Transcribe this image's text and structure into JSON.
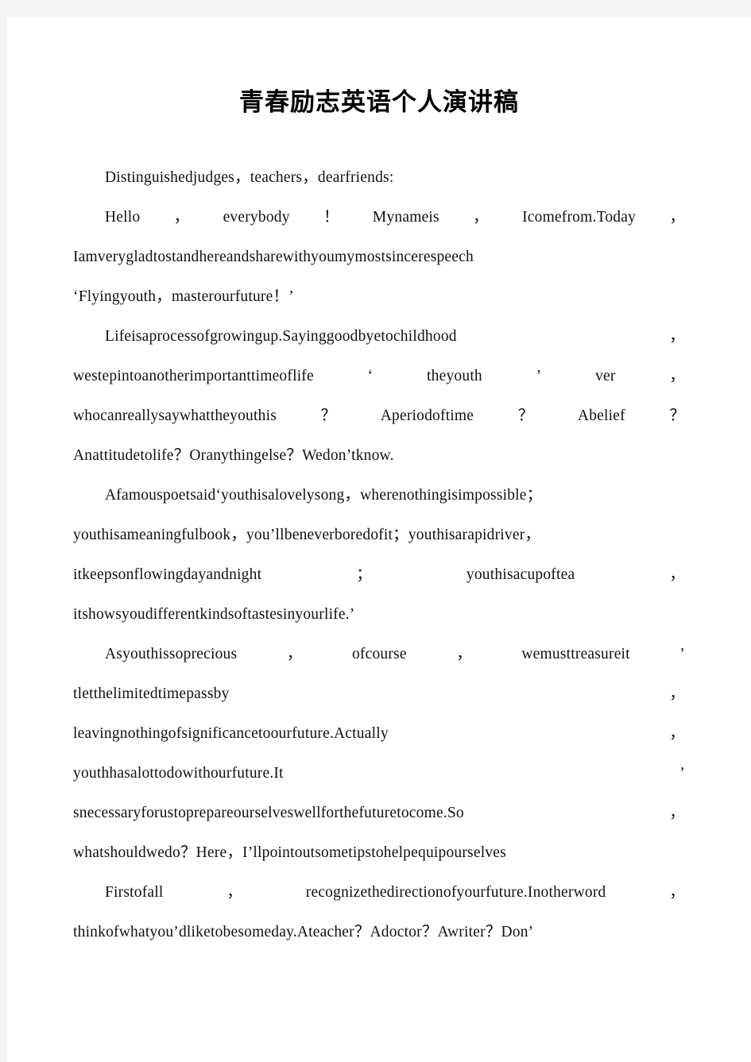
{
  "document": {
    "title": "青春励志英语个人演讲稿",
    "page_background": "#ffffff",
    "canvas_background": "#f4f4f4",
    "text_color": "#111111"
  },
  "paragraphs": [
    {
      "id": "salutation",
      "lines": [
        {
          "indent": true,
          "justify": false,
          "segments": [
            "Distinguishedjudges，teachers，dearfriends:"
          ]
        },
        {
          "indent": true,
          "justify": true,
          "segments": [
            "Hello",
            "，",
            "everybody",
            "！",
            "Mynameis",
            "，",
            "Icomefrom.Today",
            "，"
          ]
        },
        {
          "indent": false,
          "justify": false,
          "segments": [
            "Iamverygladtostandhereandsharewithyoumymostsincerespeech"
          ]
        },
        {
          "indent": false,
          "justify": false,
          "segments": [
            "‘Flyingyouth，masterourfuture！’"
          ]
        }
      ]
    },
    {
      "id": "life-process",
      "lines": [
        {
          "indent": true,
          "justify": true,
          "segments": [
            "Lifeisaprocessofgrowingup.Sayinggoodbyetochildhood",
            "，"
          ]
        },
        {
          "indent": false,
          "justify": true,
          "segments": [
            "westepintoanotherimportanttimeoflife",
            "‘",
            "theyouth",
            "’",
            "ver",
            "，"
          ]
        },
        {
          "indent": false,
          "justify": true,
          "segments": [
            "whocanreallysaywhattheyouthis",
            "？",
            "Aperiodoftime",
            "？",
            "Abelief",
            "？"
          ]
        },
        {
          "indent": false,
          "justify": false,
          "segments": [
            "Anattitudetolife？Oranythingelse？Wedon’tknow."
          ]
        }
      ]
    },
    {
      "id": "famous-poet",
      "lines": [
        {
          "indent": true,
          "justify": false,
          "segments": [
            "Afamouspoetsaid‘youthisalovelysong，wherenothingisimpossible；"
          ]
        },
        {
          "indent": false,
          "justify": false,
          "segments": [
            "youthisameaningfulbook，you’llbeneverboredofit；youthisarapidriver，"
          ]
        },
        {
          "indent": false,
          "justify": true,
          "segments": [
            "itkeepsonflowingdayandnight",
            "；",
            "youthisacupoftea",
            "，"
          ]
        },
        {
          "indent": false,
          "justify": false,
          "segments": [
            "itshowsyoudifferentkindsoftastesinyourlife.’"
          ]
        }
      ]
    },
    {
      "id": "treasure-youth",
      "lines": [
        {
          "indent": true,
          "justify": true,
          "segments": [
            "Asyouthissoprecious",
            "，",
            "ofcourse",
            "，",
            "wemusttreasureit",
            "’"
          ]
        },
        {
          "indent": false,
          "justify": true,
          "segments": [
            "tletthelimitedtimepassby",
            "，"
          ]
        },
        {
          "indent": false,
          "justify": true,
          "segments": [
            "leavingnothingofsignificancetoourfuture.Actually",
            "，"
          ]
        },
        {
          "indent": false,
          "justify": true,
          "segments": [
            "youthhasalottodowithourfuture.It",
            "’"
          ]
        },
        {
          "indent": false,
          "justify": true,
          "segments": [
            "snecessaryforustoprepareourselveswellforthefuturetocome.So",
            "，"
          ]
        },
        {
          "indent": false,
          "justify": false,
          "segments": [
            "whatshouldwedo？Here，I’llpointoutsometipstohelpequipourselves"
          ]
        }
      ]
    },
    {
      "id": "first-of-all",
      "lines": [
        {
          "indent": true,
          "justify": true,
          "segments": [
            "Firstofall",
            "，",
            "recognizethedirectionofyourfuture.Inotherword",
            "，"
          ]
        },
        {
          "indent": false,
          "justify": false,
          "segments": [
            "thinkofwhatyou’dliketobesomeday.Ateacher？Adoctor？Awriter？Don’"
          ]
        }
      ]
    }
  ]
}
